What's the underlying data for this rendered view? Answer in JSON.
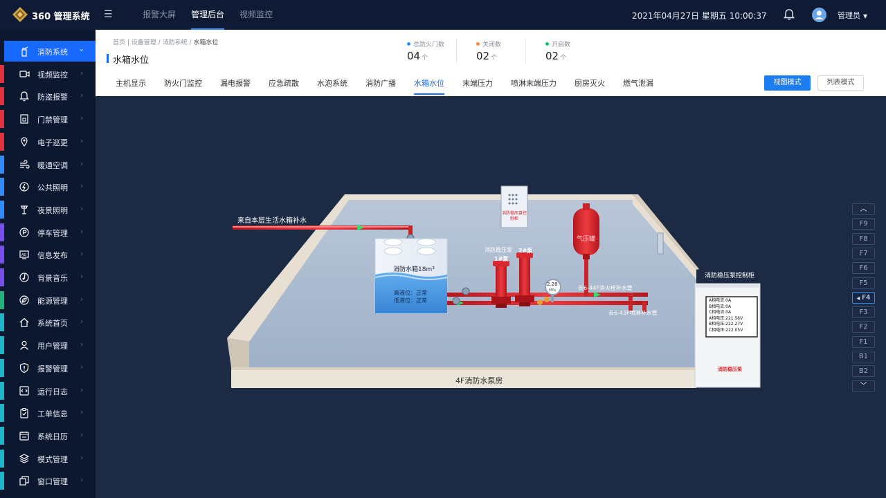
{
  "app": {
    "brand": "360 管理系统",
    "menu_icon": "menu-fold-icon",
    "logo_icon": "diamond-logo-icon"
  },
  "topnav": [
    {
      "label": "报警大屏",
      "active": false
    },
    {
      "label": "管理后台",
      "active": true
    },
    {
      "label": "视频监控",
      "active": false
    }
  ],
  "datetime": "2021年04月27日 星期五 10:00:37",
  "user": {
    "name": "管理员",
    "bell_icon": "bell-icon"
  },
  "sidebar": [
    {
      "label": "消防系统",
      "icon": "fire-extinguisher-icon",
      "active": true,
      "accent": "#1769ff"
    },
    {
      "label": "视频监控",
      "icon": "camera-icon",
      "accent": "#e0323e"
    },
    {
      "label": "防盗报警",
      "icon": "bell-icon",
      "accent": "#e0323e"
    },
    {
      "label": "门禁管理",
      "icon": "door-lock-icon",
      "accent": "#e0323e"
    },
    {
      "label": "电子巡更",
      "icon": "location-pin-icon",
      "accent": "#e0323e"
    },
    {
      "label": "暖通空调",
      "icon": "wind-icon",
      "accent": "#2f8bff"
    },
    {
      "label": "公共照明",
      "icon": "lightning-icon",
      "accent": "#2f8bff"
    },
    {
      "label": "夜景照明",
      "icon": "lamp-icon",
      "accent": "#2f8bff"
    },
    {
      "label": "停车管理",
      "icon": "parking-icon",
      "accent": "#7a4ee8"
    },
    {
      "label": "信息发布",
      "icon": "ad-board-icon",
      "accent": "#7a4ee8"
    },
    {
      "label": "背景音乐",
      "icon": "music-icon",
      "accent": "#7a4ee8"
    },
    {
      "label": "能源管理",
      "icon": "leaf-icon",
      "accent": "#22b07d"
    },
    {
      "label": "系统首页",
      "icon": "home-icon",
      "accent": "#1fb5c8"
    },
    {
      "label": "用户管理",
      "icon": "user-icon",
      "accent": "#1fb5c8"
    },
    {
      "label": "报警管理",
      "icon": "shield-alert-icon",
      "accent": "#1fb5c8"
    },
    {
      "label": "运行日志",
      "icon": "code-log-icon",
      "accent": "#1fb5c8"
    },
    {
      "label": "工单信息",
      "icon": "clipboard-icon",
      "accent": "#1fb5c8"
    },
    {
      "label": "系统日历",
      "icon": "calendar-icon",
      "accent": "#1fb5c8"
    },
    {
      "label": "模式管理",
      "icon": "layers-icon",
      "accent": "#1fb5c8"
    },
    {
      "label": "窗口管理",
      "icon": "windows-icon",
      "accent": "#1fb5c8"
    }
  ],
  "breadcrumb": [
    "首页",
    "设备管理",
    "消防系统",
    "水箱水位"
  ],
  "page_title": "水箱水位",
  "stats": [
    {
      "label": "总防火门数",
      "value": "04",
      "unit": "个",
      "color": "#2f8bff"
    },
    {
      "label": "关闭数",
      "value": "02",
      "unit": "个",
      "color": "#ff8a3d"
    },
    {
      "label": "开启数",
      "value": "02",
      "unit": "个",
      "color": "#1fbf6a"
    }
  ],
  "tabs": [
    {
      "label": "主机显示",
      "active": false
    },
    {
      "label": "防火门监控",
      "active": false
    },
    {
      "label": "漏电报警",
      "active": false
    },
    {
      "label": "应急疏散",
      "active": false
    },
    {
      "label": "水泡系统",
      "active": false
    },
    {
      "label": "消防广播",
      "active": false
    },
    {
      "label": "水箱水位",
      "active": true
    },
    {
      "label": "末端压力",
      "active": false
    },
    {
      "label": "喷淋末端压力",
      "active": false
    },
    {
      "label": "厨房灭火",
      "active": false
    },
    {
      "label": "燃气泄漏",
      "active": false
    }
  ],
  "view_modes": {
    "view": "视图模式",
    "list": "列表模式"
  },
  "scene": {
    "room_label": "4F消防水泵房",
    "inlet_label": "来自本层生活水箱补水",
    "tank_label": "消防水箱18m³",
    "tank_high": "高液位：正常",
    "tank_low": "低液位：正常",
    "pump_group": "消防稳压泵",
    "pump1": "1#泵",
    "pump2": "2#泵",
    "gauge_value": "2.28",
    "gauge_unit": "MPa",
    "vessel_label": "气压罐",
    "wall_cabinet_label": "消防稳压泵控制柜",
    "outlet1": "去6-44F消火栓补水管",
    "outlet2": "去6-43F喷淋补水管",
    "cabinet_title": "消防稳压泵控制柜",
    "cabinet_readings": [
      "A相电流:0A",
      "B相电流:0A",
      "C相电流:0A",
      "A相电压:221.56V",
      "B相电压:222.27V",
      "C相电压:222.05V"
    ],
    "cabinet_name": "消防稳压泵"
  },
  "floors": {
    "up_icon": "chevron-up-icon",
    "down_icon": "chevron-down-icon",
    "items": [
      {
        "label": "F9",
        "active": false
      },
      {
        "label": "F8",
        "active": false
      },
      {
        "label": "F7",
        "active": false
      },
      {
        "label": "F6",
        "active": false
      },
      {
        "label": "F5",
        "active": false
      },
      {
        "label": "F4",
        "active": true
      },
      {
        "label": "F3",
        "active": false
      },
      {
        "label": "F2",
        "active": false
      },
      {
        "label": "F1",
        "active": false
      },
      {
        "label": "B1",
        "active": false
      },
      {
        "label": "B2",
        "active": false
      }
    ]
  }
}
